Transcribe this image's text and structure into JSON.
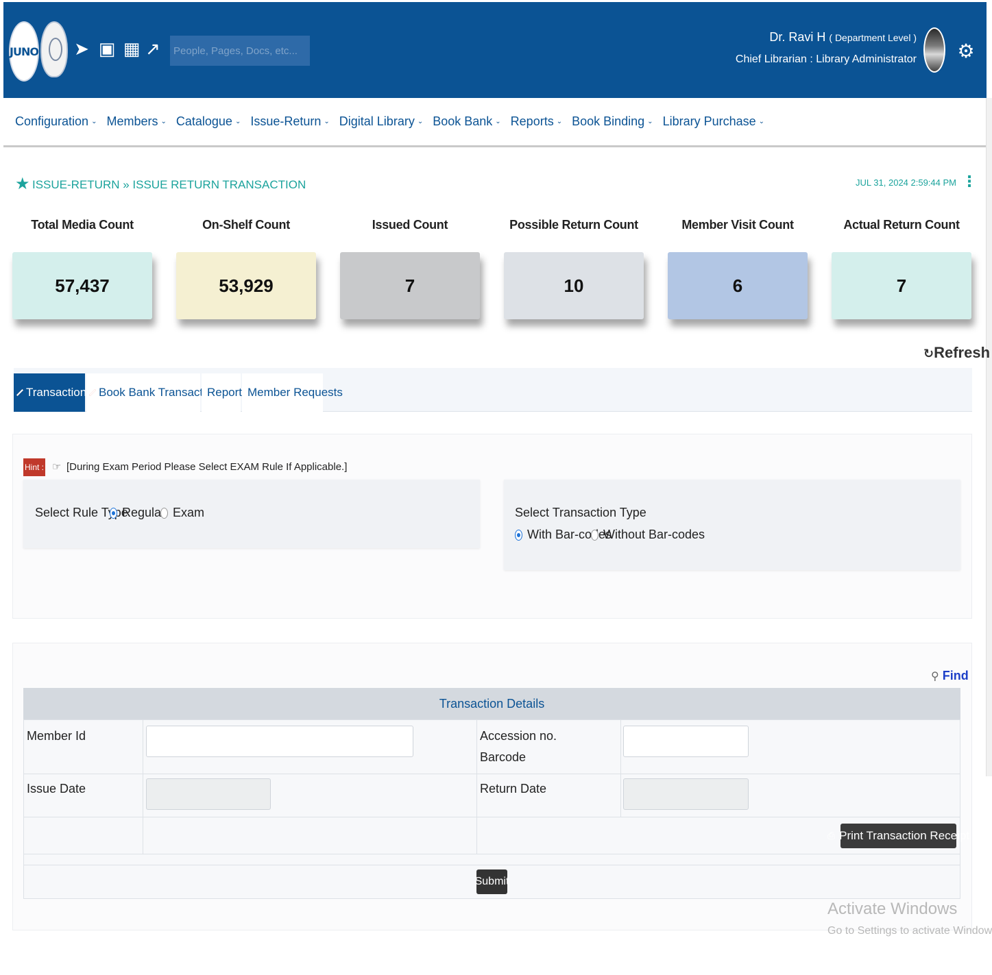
{
  "header": {
    "logo_text": "JUNO",
    "search_placeholder": "People, Pages, Docs, etc...",
    "user_name": "Dr. Ravi H",
    "user_level": "( Department Level )",
    "user_role": "Chief Librarian : Library Administrator",
    "icons": [
      "announce-icon",
      "briefcase-icon",
      "qrcode-icon",
      "external-link-icon",
      "gear-icon"
    ]
  },
  "nav": {
    "items": [
      {
        "label": "Configuration"
      },
      {
        "label": "Members"
      },
      {
        "label": "Catalogue"
      },
      {
        "label": "Issue-Return"
      },
      {
        "label": "Digital Library"
      },
      {
        "label": "Book Bank"
      },
      {
        "label": "Reports"
      },
      {
        "label": "Book Binding"
      },
      {
        "label": "Library Purchase"
      }
    ]
  },
  "breadcrumb": {
    "text": "ISSUE-RETURN » ISSUE RETURN TRANSACTION",
    "datetime": "JUL 31, 2024  2:59:44 PM"
  },
  "stats": [
    {
      "label": "Total Media Count",
      "value": "57,437",
      "color": "#d4efec"
    },
    {
      "label": "On-Shelf Count",
      "value": "53,929",
      "color": "#f5f0d2"
    },
    {
      "label": "Issued Count",
      "value": "7",
      "color": "#c8c9cb"
    },
    {
      "label": "Possible Return Count",
      "value": "10",
      "color": "#dde1e6"
    },
    {
      "label": "Member Visit Count",
      "value": "6",
      "color": "#b2c6e4"
    },
    {
      "label": "Actual Return Count",
      "value": "7",
      "color": "#d4efec"
    }
  ],
  "refresh_label": "Refresh",
  "tabs": [
    {
      "label": "Transaction",
      "active": true
    },
    {
      "label": "Book Bank Transaction"
    },
    {
      "label": "Report"
    },
    {
      "label": "Member Requests"
    }
  ],
  "hint": {
    "badge": "Hint :",
    "text": "[During Exam Period Please Select EXAM Rule If Applicable.]"
  },
  "rule_type": {
    "label": "Select Rule Type",
    "options": [
      "Regular",
      "Exam"
    ],
    "selected": "Regular"
  },
  "transaction_type": {
    "label": "Select Transaction Type",
    "options": [
      "With Bar-codes",
      "Without Bar-codes"
    ],
    "selected": "With Bar-codes"
  },
  "find_label": "Find",
  "transaction": {
    "title": "Transaction Details",
    "member_id_label": "Member Id",
    "member_id_value": "",
    "accession_label": "Accession no.",
    "barcode_label": "Barcode",
    "accession_value": "",
    "issue_date_label": "Issue Date",
    "issue_date_value": "",
    "return_date_label": "Return Date",
    "return_date_value": "",
    "print_label": "Print Transaction Receipt",
    "submit_label": "Submit"
  },
  "watermark": {
    "line1": "Activate Windows",
    "line2": "Go to Settings to activate Windows."
  }
}
